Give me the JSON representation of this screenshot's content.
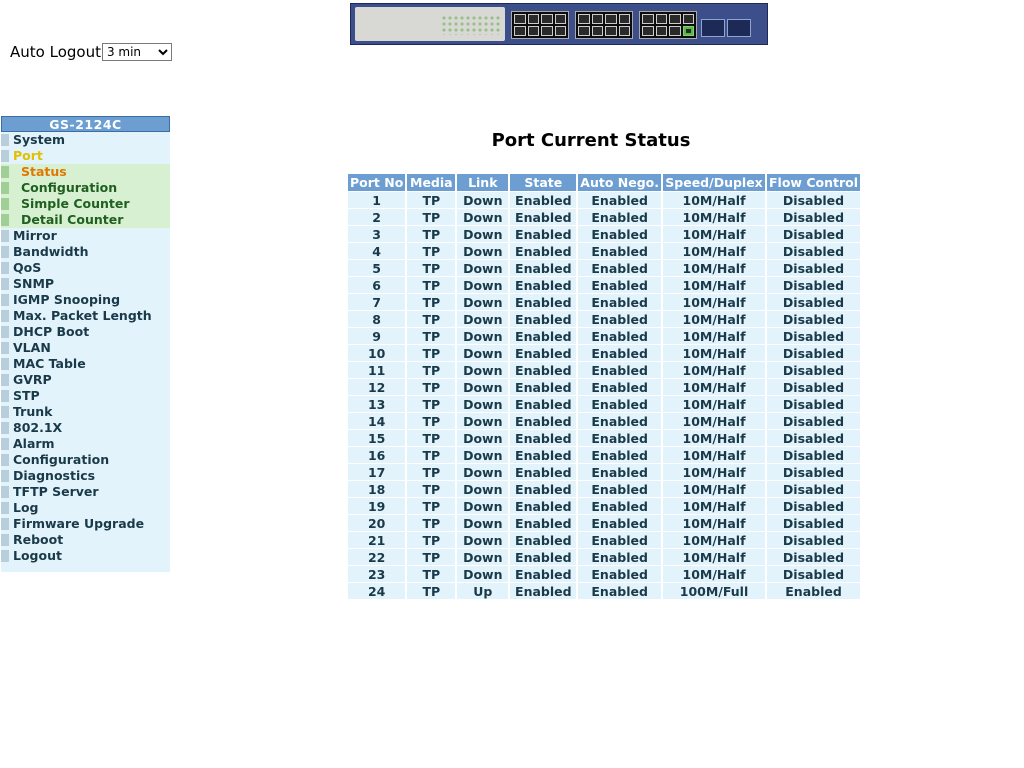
{
  "autologout": {
    "label": "Auto Logout",
    "selected": "3 min"
  },
  "sidebar": {
    "title": "GS-2124C",
    "items": [
      {
        "label": "System"
      },
      {
        "label": "Port",
        "active": true,
        "children": [
          {
            "label": "Status",
            "active": true
          },
          {
            "label": "Configuration"
          },
          {
            "label": "Simple Counter"
          },
          {
            "label": "Detail Counter"
          }
        ]
      },
      {
        "label": "Mirror"
      },
      {
        "label": "Bandwidth"
      },
      {
        "label": "QoS"
      },
      {
        "label": "SNMP"
      },
      {
        "label": "IGMP Snooping"
      },
      {
        "label": "Max. Packet Length"
      },
      {
        "label": "DHCP Boot"
      },
      {
        "label": "VLAN"
      },
      {
        "label": "MAC Table"
      },
      {
        "label": "GVRP"
      },
      {
        "label": "STP"
      },
      {
        "label": "Trunk"
      },
      {
        "label": "802.1X"
      },
      {
        "label": "Alarm"
      },
      {
        "label": "Configuration"
      },
      {
        "label": "Diagnostics"
      },
      {
        "label": "TFTP Server"
      },
      {
        "label": "Log"
      },
      {
        "label": "Firmware Upgrade"
      },
      {
        "label": "Reboot"
      },
      {
        "label": "Logout"
      }
    ]
  },
  "main": {
    "title": "Port Current Status",
    "table": {
      "headers": [
        "Port No",
        "Media",
        "Link",
        "State",
        "Auto Nego.",
        "Speed/Duplex",
        "Flow Control"
      ],
      "rows": [
        [
          "1",
          "TP",
          "Down",
          "Enabled",
          "Enabled",
          "10M/Half",
          "Disabled"
        ],
        [
          "2",
          "TP",
          "Down",
          "Enabled",
          "Enabled",
          "10M/Half",
          "Disabled"
        ],
        [
          "3",
          "TP",
          "Down",
          "Enabled",
          "Enabled",
          "10M/Half",
          "Disabled"
        ],
        [
          "4",
          "TP",
          "Down",
          "Enabled",
          "Enabled",
          "10M/Half",
          "Disabled"
        ],
        [
          "5",
          "TP",
          "Down",
          "Enabled",
          "Enabled",
          "10M/Half",
          "Disabled"
        ],
        [
          "6",
          "TP",
          "Down",
          "Enabled",
          "Enabled",
          "10M/Half",
          "Disabled"
        ],
        [
          "7",
          "TP",
          "Down",
          "Enabled",
          "Enabled",
          "10M/Half",
          "Disabled"
        ],
        [
          "8",
          "TP",
          "Down",
          "Enabled",
          "Enabled",
          "10M/Half",
          "Disabled"
        ],
        [
          "9",
          "TP",
          "Down",
          "Enabled",
          "Enabled",
          "10M/Half",
          "Disabled"
        ],
        [
          "10",
          "TP",
          "Down",
          "Enabled",
          "Enabled",
          "10M/Half",
          "Disabled"
        ],
        [
          "11",
          "TP",
          "Down",
          "Enabled",
          "Enabled",
          "10M/Half",
          "Disabled"
        ],
        [
          "12",
          "TP",
          "Down",
          "Enabled",
          "Enabled",
          "10M/Half",
          "Disabled"
        ],
        [
          "13",
          "TP",
          "Down",
          "Enabled",
          "Enabled",
          "10M/Half",
          "Disabled"
        ],
        [
          "14",
          "TP",
          "Down",
          "Enabled",
          "Enabled",
          "10M/Half",
          "Disabled"
        ],
        [
          "15",
          "TP",
          "Down",
          "Enabled",
          "Enabled",
          "10M/Half",
          "Disabled"
        ],
        [
          "16",
          "TP",
          "Down",
          "Enabled",
          "Enabled",
          "10M/Half",
          "Disabled"
        ],
        [
          "17",
          "TP",
          "Down",
          "Enabled",
          "Enabled",
          "10M/Half",
          "Disabled"
        ],
        [
          "18",
          "TP",
          "Down",
          "Enabled",
          "Enabled",
          "10M/Half",
          "Disabled"
        ],
        [
          "19",
          "TP",
          "Down",
          "Enabled",
          "Enabled",
          "10M/Half",
          "Disabled"
        ],
        [
          "20",
          "TP",
          "Down",
          "Enabled",
          "Enabled",
          "10M/Half",
          "Disabled"
        ],
        [
          "21",
          "TP",
          "Down",
          "Enabled",
          "Enabled",
          "10M/Half",
          "Disabled"
        ],
        [
          "22",
          "TP",
          "Down",
          "Enabled",
          "Enabled",
          "10M/Half",
          "Disabled"
        ],
        [
          "23",
          "TP",
          "Down",
          "Enabled",
          "Enabled",
          "10M/Half",
          "Disabled"
        ],
        [
          "24",
          "TP",
          "Up",
          "Enabled",
          "Enabled",
          "100M/Full",
          "Enabled"
        ]
      ]
    }
  },
  "colors": {
    "header_bg": "#6c9ed2",
    "row_bg": "#e2f3fb",
    "submenu_bg": "#d8f0d2",
    "active_item": "#e0c000",
    "active_subitem": "#e07800"
  }
}
